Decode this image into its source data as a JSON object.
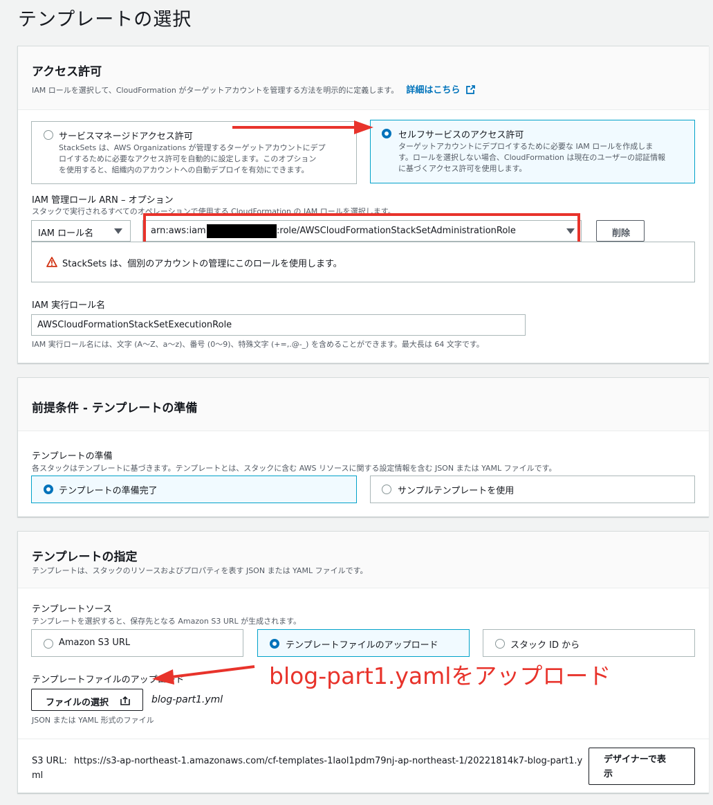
{
  "page": {
    "title": "テンプレートの選択"
  },
  "access": {
    "title": "アクセス許可",
    "description": "IAM ロールを選択して、CloudFormation がターゲットアカウントを管理する方法を明示的に定義します。",
    "details_link": "詳細はこちら",
    "options": [
      {
        "title": "サービスマネージドアクセス許可",
        "desc_lines": [
          "StackSets は、AWS Organizations が管理するターゲットアカウントにデプ",
          "ロイするために必要なアクセス許可を自動的に設定します。このオプション",
          "を使用すると、組織内のアカウントへの自動デプロイを有効にできます。"
        ],
        "selected": false
      },
      {
        "title": "セルフサービスのアクセス許可",
        "desc_lines": [
          "ターゲットアカウントにデプロイするために必要な IAM ロールを作成しま",
          "す。ロールを選択しない場合、CloudFormation は現在のユーザーの認証情報",
          "に基づくアクセス許可を使用します。"
        ],
        "selected": true
      }
    ],
    "admin_role": {
      "label": "IAM 管理ロール ARN – オプション",
      "description": "スタックで実行されるすべてのオペレーションで使用する CloudFormation の IAM ロールを選択します。",
      "type_select": "IAM ロール名",
      "arn_prefix": "arn:aws:iam::",
      "arn_suffix": ":role/AWSCloudFormationStackSetAdministrationRole",
      "remove_button": "削除",
      "warning": "StackSets は、個別のアカウントの管理にこのロールを使用します。"
    },
    "exec_role": {
      "label": "IAM 実行ロール名",
      "value": "AWSCloudFormationStackSetExecutionRole",
      "hint": "IAM 実行ロール名には、文字 (A〜Z、a〜z)、番号 (0〜9)、特殊文字 (+=,.@-_) を含めることができます。最大長は 64 文字です。"
    }
  },
  "prereq": {
    "title": "前提条件 - テンプレートの準備",
    "label": "テンプレートの準備",
    "description": "各スタックはテンプレートに基づきます。テンプレートとは、スタックに含む AWS リソースに関する設定情報を含む JSON または YAML ファイルです。",
    "options": [
      {
        "label": "テンプレートの準備完了",
        "selected": true
      },
      {
        "label": "サンプルテンプレートを使用",
        "selected": false
      }
    ]
  },
  "spec": {
    "title": "テンプレートの指定",
    "description": "テンプレートは、スタックのリソースおよびプロパティを表す JSON または YAML ファイルです。",
    "source_label": "テンプレートソース",
    "source_desc": "テンプレートを選択すると、保存先となる Amazon S3 URL が生成されます。",
    "sources": [
      {
        "label": "Amazon S3 URL",
        "selected": false
      },
      {
        "label": "テンプレートファイルのアップロード",
        "selected": true
      },
      {
        "label": "スタック ID から",
        "selected": false
      }
    ],
    "upload_label": "テンプレートファイルのアップロード",
    "choose_file_button": "ファイルの選択",
    "file_name": "blog-part1.yml",
    "file_hint": "JSON または YAML 形式のファイル",
    "s3_url_label": "S3 URL:",
    "s3_url_line1": "https://s3-ap-northeast-1.amazonaws.com/cf-templates-1laol1pdm79nj-ap-northeast-1/20221814k7-blog-part1.y",
    "s3_url_line2": "ml",
    "designer_button_line1": "デザイナーで表",
    "designer_button_line2": "示"
  },
  "annotation": {
    "text": "blog-part1.yamlをアップロード",
    "color": "#e8332b"
  }
}
